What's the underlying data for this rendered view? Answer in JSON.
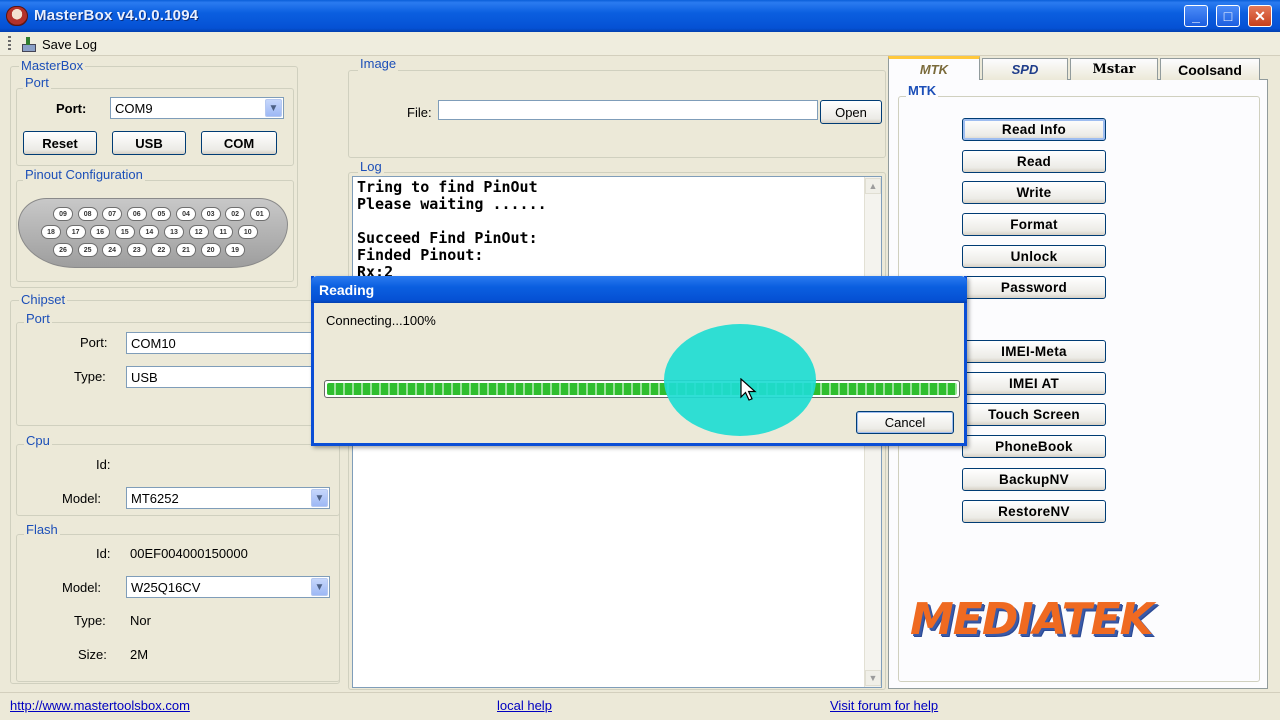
{
  "window": {
    "title": "MasterBox v4.0.0.1094",
    "controls": [
      "_",
      "□",
      "✕"
    ]
  },
  "toolbar": {
    "save_log": "Save Log"
  },
  "masterbox": {
    "group_label": "MasterBox",
    "port_group": "Port",
    "port_label": "Port:",
    "port_value": "COM9",
    "buttons": {
      "reset": "Reset",
      "usb": "USB",
      "com": "COM"
    },
    "pinout_label": "Pinout Configuration",
    "pins_row1": [
      "09",
      "08",
      "07",
      "06",
      "05",
      "04",
      "03",
      "02",
      "01"
    ],
    "pins_row2": [
      "18",
      "17",
      "16",
      "15",
      "14",
      "13",
      "12",
      "11",
      "10"
    ],
    "pins_row3": [
      "26",
      "25",
      "24",
      "23",
      "22",
      "21",
      "20",
      "19"
    ]
  },
  "chipset": {
    "group_label": "Chipset",
    "port_group": "Port",
    "port_label": "Port:",
    "port_value": "COM10",
    "type_label": "Type:",
    "type_value": "USB"
  },
  "cpu": {
    "group_label": "Cpu",
    "id_label": "Id:",
    "model_label": "Model:",
    "model_value": "MT6252"
  },
  "flash": {
    "group_label": "Flash",
    "id_label": "Id:",
    "id_value": "00EF004000150000",
    "model_label": "Model:",
    "model_value": "W25Q16CV",
    "type_label": "Type:",
    "type_value": "Nor",
    "size_label": "Size:",
    "size_value": "2M"
  },
  "image": {
    "group_label": "Image",
    "file_label": "File:",
    "file_value": "",
    "open_button": "Open"
  },
  "log": {
    "group_label": "Log",
    "text": "Tring to find PinOut\nPlease waiting ......\n\nSucceed Find PinOut:\nFinded Pinout:\nRx:2"
  },
  "tabs": {
    "mtk": "MTK",
    "spd": "SPD",
    "mstar": "Mstar",
    "coolsand": "Coolsand"
  },
  "mtk_panel": {
    "group_label": "MTK",
    "buttons": [
      "Read Info",
      "Read",
      "Write",
      "Format",
      "Unlock",
      "Password",
      "IMEI-Meta",
      "IMEI AT",
      "Touch Screen",
      "PhoneBook",
      "BackupNV",
      "RestoreNV"
    ],
    "logo": "MEDIATEK"
  },
  "dialog": {
    "title": "Reading",
    "status": "Connecting...100%",
    "progress": 1.0,
    "cancel": "Cancel"
  },
  "statusbar": {
    "site": "http://www.mastertoolsbox.com",
    "help": "local help",
    "forum": "Visit forum for help"
  }
}
